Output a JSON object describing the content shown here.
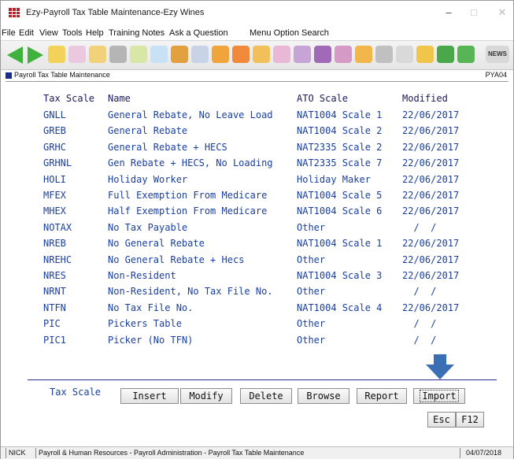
{
  "window": {
    "title": "Ezy-Payroll Tax Table Maintenance-Ezy Wines",
    "minimize": "–",
    "maximize": "□",
    "close": "✕"
  },
  "menu": [
    "File",
    "Edit",
    "View",
    "Tools",
    "Help",
    "Training Notes",
    "Ask a Question",
    "Menu Option Search"
  ],
  "toolbar": {
    "news_label": "NEWS",
    "icons": [
      "back-arrow-icon",
      "forward-arrow-icon",
      "folder-icon",
      "edit-icon",
      "pencil-icon",
      "printer-icon",
      "money-icon",
      "document-icon",
      "users-icon",
      "wand-icon",
      "pie-icon",
      "cube-icon",
      "tools-icon",
      "people-icon",
      "chart-icon",
      "grapes-icon",
      "book-icon",
      "briefcase-icon",
      "gear-icon",
      "window-icon",
      "box-icon",
      "leaf-icon",
      "dollar-icon",
      "news-icon"
    ]
  },
  "caption": {
    "title": "Payroll Tax Table Maintenance",
    "code": "PYA04"
  },
  "table": {
    "headers": {
      "code": "Tax Scale",
      "name": "Name",
      "ato": "ATO Scale",
      "modified": "Modified"
    },
    "rows": [
      {
        "code": "GNLL",
        "name": "General Rebate, No Leave Load",
        "ato": "NAT1004 Scale 1",
        "modified": "22/06/2017"
      },
      {
        "code": "GREB",
        "name": "General Rebate",
        "ato": "NAT1004 Scale 2",
        "modified": "22/06/2017"
      },
      {
        "code": "GRHC",
        "name": "General Rebate + HECS",
        "ato": "NAT2335 Scale 2",
        "modified": "22/06/2017"
      },
      {
        "code": "GRHNL",
        "name": "Gen Rebate + HECS, No Loading",
        "ato": "NAT2335 Scale 7",
        "modified": "22/06/2017"
      },
      {
        "code": "HOLI",
        "name": "Holiday Worker",
        "ato": "Holiday Maker",
        "modified": "22/06/2017"
      },
      {
        "code": "MFEX",
        "name": "Full Exemption From Medicare",
        "ato": "NAT1004 Scale 5",
        "modified": "22/06/2017"
      },
      {
        "code": "MHEX",
        "name": "Half Exemption From Medicare",
        "ato": "NAT1004 Scale 6",
        "modified": "22/06/2017"
      },
      {
        "code": "NOTAX",
        "name": "No Tax Payable",
        "ato": "Other",
        "modified": "  /  /"
      },
      {
        "code": "NREB",
        "name": "No General Rebate",
        "ato": "NAT1004 Scale 1",
        "modified": "22/06/2017"
      },
      {
        "code": "NREHC",
        "name": "No General Rebate + Hecs",
        "ato": "Other",
        "modified": "22/06/2017"
      },
      {
        "code": "NRES",
        "name": "Non-Resident",
        "ato": "NAT1004 Scale 3",
        "modified": "22/06/2017"
      },
      {
        "code": "NRNT",
        "name": "Non-Resident, No Tax File No.",
        "ato": "Other",
        "modified": "  /  /"
      },
      {
        "code": "NTFN",
        "name": "No Tax File No.",
        "ato": "NAT1004 Scale 4",
        "modified": "22/06/2017"
      },
      {
        "code": "PIC",
        "name": "Pickers Table",
        "ato": "Other",
        "modified": "  /  /"
      },
      {
        "code": "PIC1",
        "name": "Picker (No TFN)",
        "ato": "Other",
        "modified": "  /  /"
      }
    ]
  },
  "footer": {
    "field_label": "Tax Scale",
    "buttons": [
      "Insert",
      "Modify",
      "Delete",
      "Browse",
      "Report",
      "Import"
    ],
    "esc": "Esc",
    "f12": "F12"
  },
  "status": {
    "user": "NICK",
    "path": "Payroll & Human Resources - Payroll Administration - Payroll Tax Table Maintenance",
    "date": "04/07/2018"
  },
  "colors": {
    "accent_blue": "#1a3f9e",
    "arrow_blue": "#3a6fb5",
    "toolbar_green": "#3fb23c"
  }
}
